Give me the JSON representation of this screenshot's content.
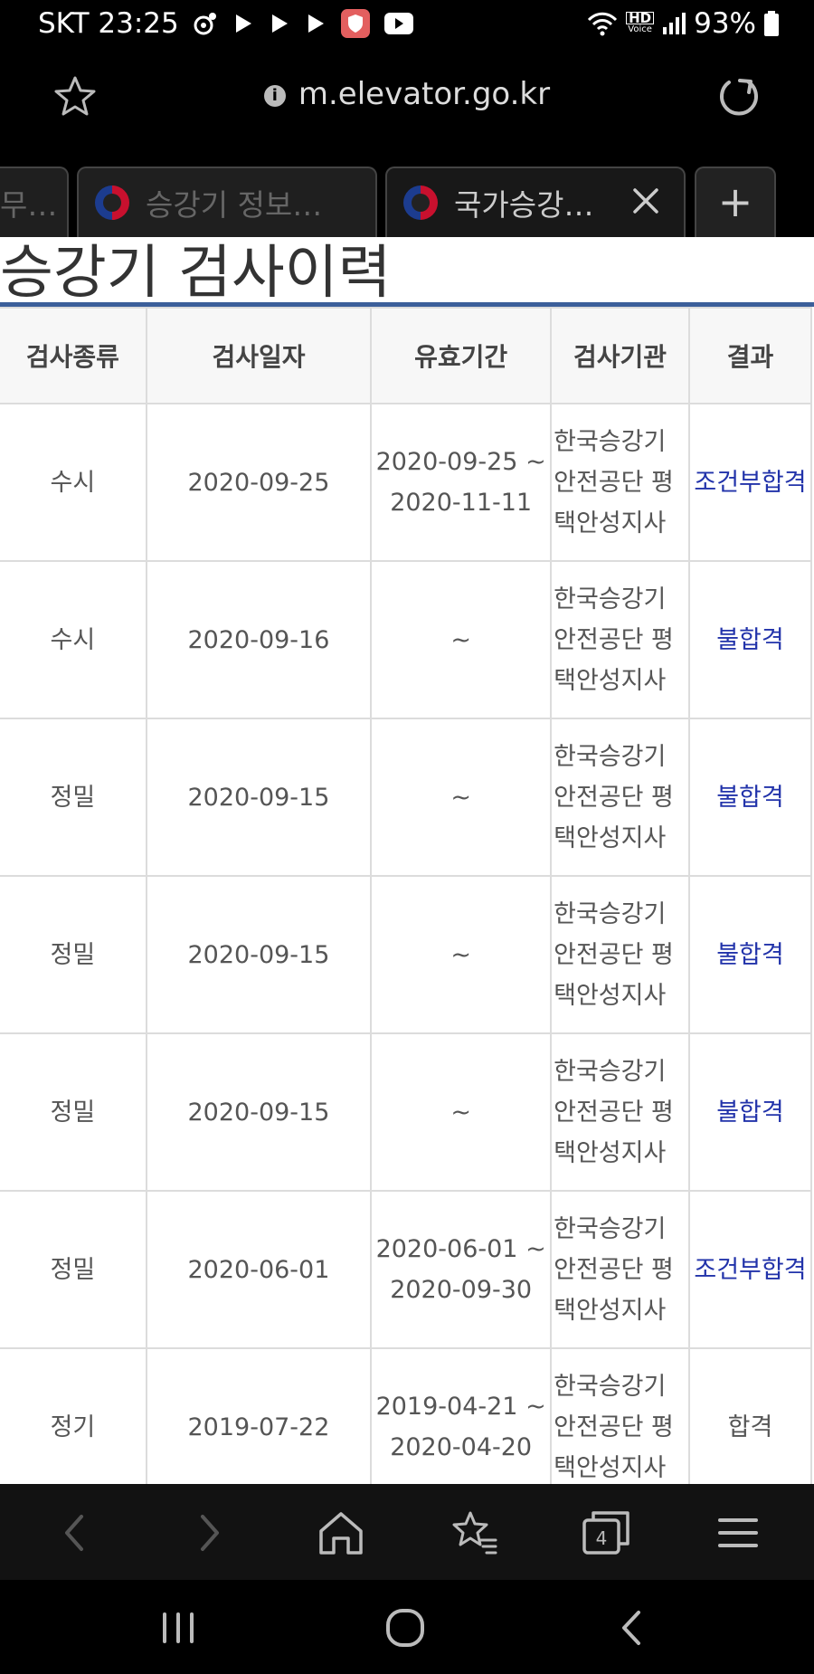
{
  "status": {
    "carrier_time": "SKT 23:25",
    "volte": "HD",
    "volte_sub": "Voice",
    "battery": "93%"
  },
  "browser": {
    "url": "m.elevator.go.kr",
    "info_glyph": "i",
    "tabs": [
      {
        "label": "무…"
      },
      {
        "label": "승강기 정보…"
      },
      {
        "label": "국가승강…"
      }
    ],
    "new_tab_glyph": "+",
    "tab_count": "4"
  },
  "page": {
    "title": "승강기 검사이력",
    "table": {
      "headers": [
        "검사종류",
        "검사일자",
        "유효기간",
        "검사기관",
        "결과"
      ],
      "rows": [
        {
          "type": "수시",
          "date": "2020-09-25",
          "valid": "2020-09-25 ~ 2020-11-11",
          "org": "한국승강기안전공단 평택안성지사",
          "result": "조건부합격"
        },
        {
          "type": "수시",
          "date": "2020-09-16",
          "valid": "~",
          "org": "한국승강기안전공단 평택안성지사",
          "result": "불합격"
        },
        {
          "type": "정밀",
          "date": "2020-09-15",
          "valid": "~",
          "org": "한국승강기안전공단 평택안성지사",
          "result": "불합격"
        },
        {
          "type": "정밀",
          "date": "2020-09-15",
          "valid": "~",
          "org": "한국승강기안전공단 평택안성지사",
          "result": "불합격"
        },
        {
          "type": "정밀",
          "date": "2020-09-15",
          "valid": "~",
          "org": "한국승강기안전공단 평택안성지사",
          "result": "불합격"
        },
        {
          "type": "정밀",
          "date": "2020-06-01",
          "valid": "2020-06-01 ~ 2020-09-30",
          "org": "한국승강기안전공단 평택안성지사",
          "result": "조건부합격"
        },
        {
          "type": "정기",
          "date": "2019-07-22",
          "valid": "2019-04-21 ~ 2020-04-20",
          "org": "한국승강기안전공단 평택안성지사",
          "result": "합격"
        }
      ]
    }
  },
  "colors": {
    "accent_rule": "#3c5f9a",
    "link_result": "#2233aa"
  }
}
